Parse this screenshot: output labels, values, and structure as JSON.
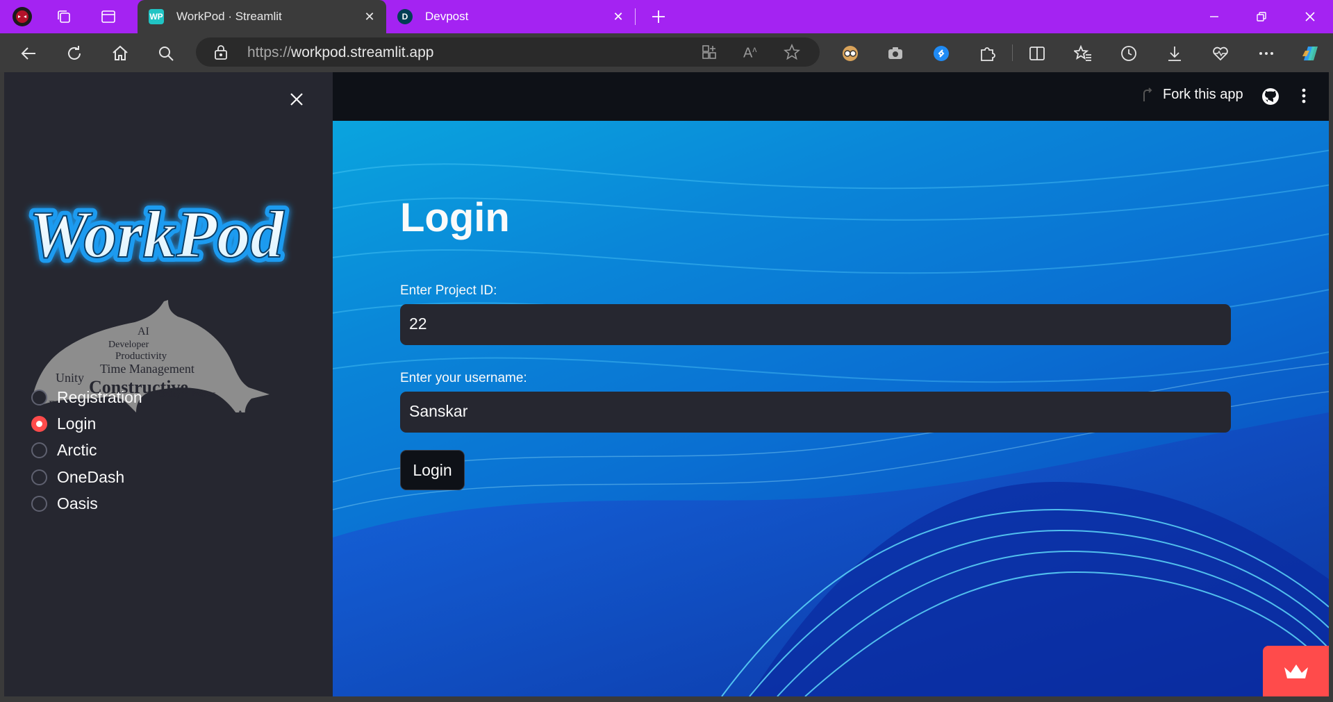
{
  "browser": {
    "tabs": [
      {
        "title": "WorkPod · Streamlit",
        "favicon_text": "WP",
        "favicon_color": "#20c4c4",
        "active": true
      },
      {
        "title": "Devpost",
        "favicon_text": "D",
        "favicon_color": "#003e54",
        "active": false
      }
    ],
    "url_scheme": "https://",
    "url_host": "workpod.streamlit.app",
    "accent_color": "#a423f2"
  },
  "header": {
    "fork_label": "Fork this app"
  },
  "sidebar": {
    "logo_text": "WorkPod",
    "nav_options": [
      {
        "label": "Registration",
        "selected": false
      },
      {
        "label": "Login",
        "selected": true
      },
      {
        "label": "Arctic",
        "selected": false
      },
      {
        "label": "OneDash",
        "selected": false
      },
      {
        "label": "Oasis",
        "selected": false
      }
    ]
  },
  "main": {
    "title": "Login",
    "project_id_label": "Enter Project ID:",
    "project_id_value": "22",
    "username_label": "Enter your username:",
    "username_value": "Sanskar",
    "login_button_label": "Login"
  },
  "colors": {
    "primary": "#ff4b4b",
    "sidebar_bg": "#262730",
    "app_bg": "#0e1117"
  }
}
